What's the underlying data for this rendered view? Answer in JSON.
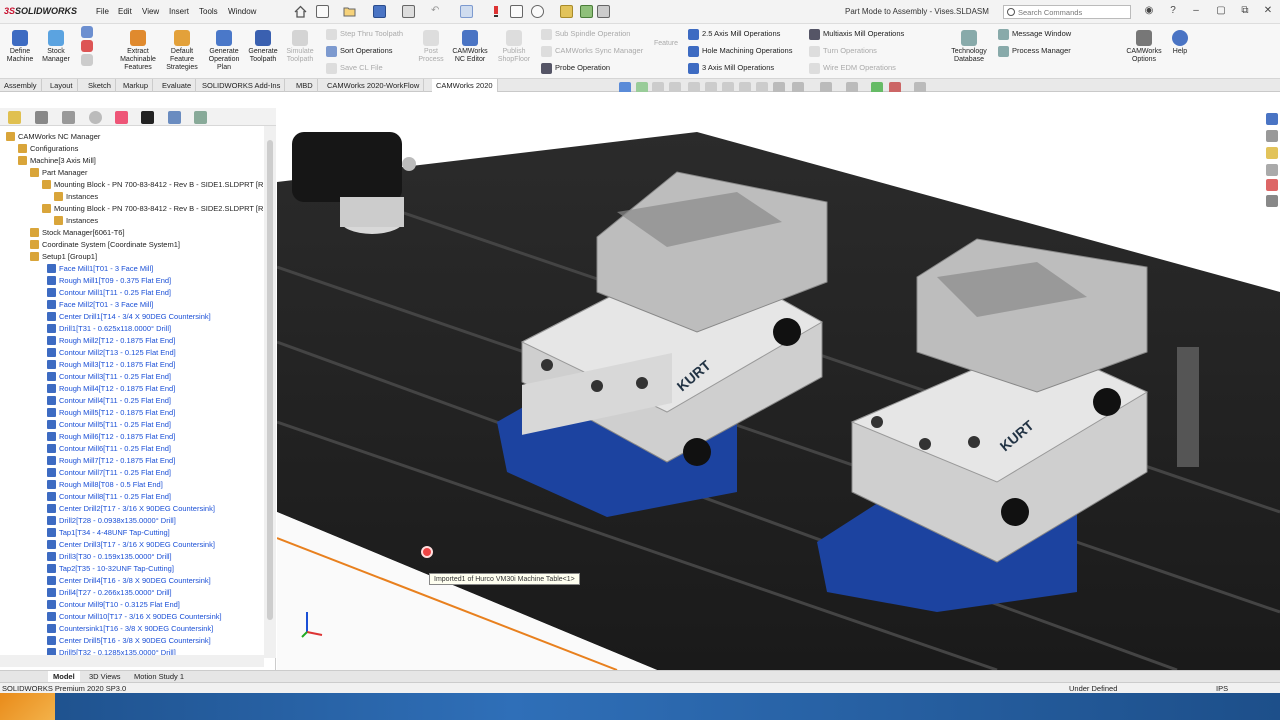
{
  "app": {
    "brand_a": "3S",
    "brand_b": "SOLIDWORKS",
    "title": "Part Mode to Assembly - Vises.SLDASM",
    "search_placeholder": "Search Commands"
  },
  "menus": [
    "File",
    "Edit",
    "View",
    "Insert",
    "Tools",
    "Window"
  ],
  "commands": {
    "define_machine": "Define Machine",
    "stock_manager": "Stock Manager",
    "extract": "Extract Machinable Features",
    "default_strategies": "Default Feature Strategies",
    "gen_plan": "Generate Operation Plan",
    "gen_toolpath": "Generate Toolpath",
    "simulate": "Simulate Toolpath",
    "step_thru": "Step Thru Toolpath",
    "sort_ops": "Sort Operations",
    "save_cl": "Save CL File",
    "post": "Post Process",
    "nc_editor": "CAMWorks NC Editor",
    "publish": "Publish ShopFloor",
    "sub_spindle": "Sub Spindle Operation",
    "sync_manager": "CAMWorks Sync Manager",
    "probe": "Probe Operation",
    "feature": "Feature",
    "axis25": "2.5 Axis Mill Operations",
    "hole": "Hole Machining Operations",
    "axis3": "3 Axis Mill Operations",
    "multiaxis": "Multiaxis Mill Operations",
    "turn": "Turn Operations",
    "wire": "Wire EDM Operations",
    "techdb": "Technology Database",
    "msg_window": "Message Window",
    "process_mgr": "Process Manager",
    "options": "CAMWorks Options",
    "help": "Help"
  },
  "tabs": [
    "Assembly",
    "Layout",
    "Sketch",
    "Markup",
    "Evaluate",
    "SOLIDWORKS Add-Ins",
    "MBD",
    "CAMWorks 2020-WorkFlow",
    "CAMWorks 2020"
  ],
  "tree": [
    {
      "label": "CAMWorks NC Manager",
      "kind": "pl",
      "indent": 0
    },
    {
      "label": "Configurations",
      "kind": "pl",
      "indent": 1
    },
    {
      "label": "Machine[3 Axis Mill]",
      "kind": "pl",
      "indent": 1
    },
    {
      "label": "Part Manager",
      "kind": "pl",
      "indent": 2
    },
    {
      "label": "Mounting Block - PN 700-83-8412 - Rev B - SIDE1.SLDPRT [R",
      "kind": "pl",
      "indent": 3
    },
    {
      "label": "Instances",
      "kind": "pl",
      "indent": 4
    },
    {
      "label": "Mounting Block - PN 700-83-8412 - Rev B - SIDE2.SLDPRT [R",
      "kind": "pl",
      "indent": 3
    },
    {
      "label": "Instances",
      "kind": "pl",
      "indent": 4
    },
    {
      "label": "Stock Manager[6061-T6]",
      "kind": "pl",
      "indent": 2
    },
    {
      "label": "Coordinate System [Coordinate System1]",
      "kind": "pl",
      "indent": 2
    },
    {
      "label": "Setup1 [Group1]",
      "kind": "pl",
      "indent": 2
    },
    {
      "label": "Face Mill1[T01 - 3 Face Mill]",
      "kind": "op",
      "indent": 3
    },
    {
      "label": "Rough Mill1[T09 - 0.375 Flat End]",
      "kind": "op",
      "indent": 3
    },
    {
      "label": "Contour Mill1[T11 - 0.25 Flat End]",
      "kind": "op",
      "indent": 3
    },
    {
      "label": "Face Mill2[T01 - 3 Face Mill]",
      "kind": "op",
      "indent": 3
    },
    {
      "label": "Center Drill1[T14 - 3/4 X 90DEG Countersink]",
      "kind": "op",
      "indent": 3
    },
    {
      "label": "Drill1[T31 - 0.625x118.0000° Drill]",
      "kind": "op",
      "indent": 3
    },
    {
      "label": "Rough Mill2[T12 - 0.1875 Flat End]",
      "kind": "op",
      "indent": 3
    },
    {
      "label": "Contour Mill2[T13 - 0.125 Flat End]",
      "kind": "op",
      "indent": 3
    },
    {
      "label": "Rough Mill3[T12 - 0.1875 Flat End]",
      "kind": "op",
      "indent": 3
    },
    {
      "label": "Contour Mill3[T11 - 0.25 Flat End]",
      "kind": "op",
      "indent": 3
    },
    {
      "label": "Rough Mill4[T12 - 0.1875 Flat End]",
      "kind": "op",
      "indent": 3
    },
    {
      "label": "Contour Mill4[T11 - 0.25 Flat End]",
      "kind": "op",
      "indent": 3
    },
    {
      "label": "Rough Mill5[T12 - 0.1875 Flat End]",
      "kind": "op",
      "indent": 3
    },
    {
      "label": "Contour Mill5[T11 - 0.25 Flat End]",
      "kind": "op",
      "indent": 3
    },
    {
      "label": "Rough Mill6[T12 - 0.1875 Flat End]",
      "kind": "op",
      "indent": 3
    },
    {
      "label": "Contour Mill6[T11 - 0.25 Flat End]",
      "kind": "op",
      "indent": 3
    },
    {
      "label": "Rough Mill7[T12 - 0.1875 Flat End]",
      "kind": "op",
      "indent": 3
    },
    {
      "label": "Contour Mill7[T11 - 0.25 Flat End]",
      "kind": "op",
      "indent": 3
    },
    {
      "label": "Rough Mill8[T08 - 0.5 Flat End]",
      "kind": "op",
      "indent": 3
    },
    {
      "label": "Contour Mill8[T11 - 0.25 Flat End]",
      "kind": "op",
      "indent": 3
    },
    {
      "label": "Center Drill2[T17 - 3/16 X 90DEG Countersink]",
      "kind": "op",
      "indent": 3
    },
    {
      "label": "Drill2[T28 - 0.0938x135.0000° Drill]",
      "kind": "op",
      "indent": 3
    },
    {
      "label": "Tap1[T34 - 4-48UNF Tap-Cutting]",
      "kind": "op",
      "indent": 3
    },
    {
      "label": "Center Drill3[T17 - 3/16 X 90DEG Countersink]",
      "kind": "op",
      "indent": 3
    },
    {
      "label": "Drill3[T30 - 0.159x135.0000° Drill]",
      "kind": "op",
      "indent": 3
    },
    {
      "label": "Tap2[T35 - 10-32UNF Tap-Cutting]",
      "kind": "op",
      "indent": 3
    },
    {
      "label": "Center Drill4[T16 - 3/8 X 90DEG Countersink]",
      "kind": "op",
      "indent": 3
    },
    {
      "label": "Drill4[T27 - 0.266x135.0000° Drill]",
      "kind": "op",
      "indent": 3
    },
    {
      "label": "Contour Mill9[T10 - 0.3125 Flat End]",
      "kind": "op",
      "indent": 3
    },
    {
      "label": "Contour Mill10[T17 - 3/16 X 90DEG Countersink]",
      "kind": "op",
      "indent": 3
    },
    {
      "label": "Countersink1[T16 - 3/8 X 90DEG Countersink]",
      "kind": "op",
      "indent": 3
    },
    {
      "label": "Center Drill5[T16 - 3/8 X 90DEG Countersink]",
      "kind": "op",
      "indent": 3
    },
    {
      "label": "Drill5[T32 - 0.1285x135.0000° Drill]",
      "kind": "op",
      "indent": 3
    }
  ],
  "viewport": {
    "tooltip": "Imported1 of Hurco VM30i Machine Table<1>",
    "vise_brand": "KURT"
  },
  "bottom_tabs": [
    "Model",
    "3D Views",
    "Motion Study 1"
  ],
  "status": {
    "left": "SOLIDWORKS Premium 2020 SP3.0",
    "state": "Under Defined",
    "units": "IPS"
  }
}
